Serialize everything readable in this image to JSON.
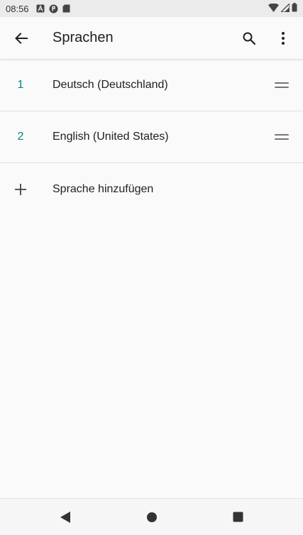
{
  "status_bar": {
    "time": "08:56",
    "left_icons": [
      "a-notification-icon",
      "circle-app-notification-icon",
      "sd-card-icon"
    ],
    "right_icons": [
      "wifi-icon",
      "cell-signal-icon",
      "battery-icon"
    ]
  },
  "app_bar": {
    "title": "Sprachen",
    "back_icon": "arrow-back-icon",
    "search_icon": "search-icon",
    "menu_icon": "more-vert-icon"
  },
  "languages": [
    {
      "number": "1",
      "label": "Deutsch (Deutschland)"
    },
    {
      "number": "2",
      "label": "English (United States)"
    }
  ],
  "add_language": {
    "label": "Sprache hinzufügen",
    "icon": "plus-icon"
  },
  "nav_bar": {
    "back_icon": "nav-back-icon",
    "home_icon": "nav-home-icon",
    "recents_icon": "nav-recents-icon"
  },
  "colors": {
    "accent": "#00897b",
    "text_primary": "#212121",
    "background": "#fafafa",
    "divider": "#dedede"
  }
}
